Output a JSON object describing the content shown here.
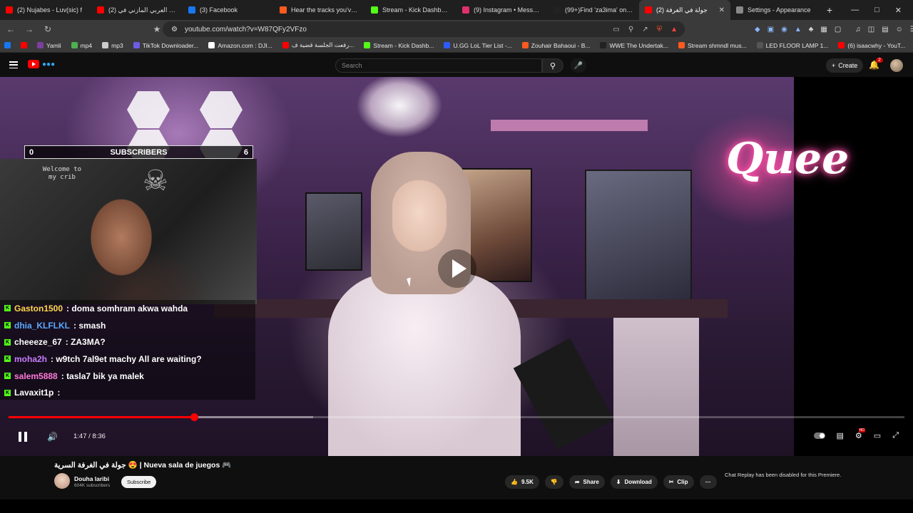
{
  "browser": {
    "tabs": [
      {
        "title": "(2) Nujabes - Luv(sic) f",
        "color": "#ff0000",
        "active": false
      },
      {
        "title": "محمد العربي المازني في (2)",
        "color": "#ff0000",
        "active": false
      },
      {
        "title": "(3) Facebook",
        "color": "#1877f2",
        "active": false
      },
      {
        "title": "Hear the tracks you've lik",
        "color": "#ff5a1f",
        "active": false
      },
      {
        "title": "Stream - Kick Dashboard",
        "color": "#53fc18",
        "active": false
      },
      {
        "title": "(9) Instagram • Messages",
        "color": "#e1306c",
        "active": false
      },
      {
        "title": "(99+)Find 'za3ima' on TikT",
        "color": "#222222",
        "active": false
      },
      {
        "title": "جولة في الغرفة (2)",
        "color": "#ff0000",
        "active": true
      },
      {
        "title": "Settings - Appearance",
        "color": "#888888",
        "active": false
      }
    ],
    "url": "youtube.com/watch?v=W87QFy2VFzo",
    "bookmarks": [
      {
        "label": "",
        "color": "#1877f2"
      },
      {
        "label": "",
        "color": "#ff0000"
      },
      {
        "label": "Yamli",
        "color": "#7b3fa0"
      },
      {
        "label": "mp4",
        "color": "#4caf50"
      },
      {
        "label": "mp3",
        "color": "#cccccc"
      },
      {
        "label": "TikTok Downloader...",
        "color": "#6c5ce7"
      },
      {
        "label": "Amazon.com : DJI...",
        "color": "#ffffff"
      },
      {
        "label": "رفعت الجلسة قضية ف...",
        "color": "#ff0000"
      },
      {
        "label": "Stream - Kick Dashb...",
        "color": "#53fc18"
      },
      {
        "label": "U.GG LoL Tier List -...",
        "color": "#2e5bff"
      },
      {
        "label": "Zouhair Bahaoui - B...",
        "color": "#ff5a1f"
      },
      {
        "label": "WWE The Undertak...",
        "color": "#222222"
      },
      {
        "label": "Stream shmndl mus...",
        "color": "#ff5a1f"
      },
      {
        "label": "LED FLOOR LAMP 1...",
        "color": "#555555"
      },
      {
        "label": "(6) isaacwhy - YouT...",
        "color": "#ff0000"
      },
      {
        "label": "st",
        "color": "#ff0000"
      }
    ]
  },
  "youtube": {
    "search_placeholder": "Search",
    "create_label": "Create",
    "notification_count": "2"
  },
  "overlay": {
    "subscribers_label": "SUBSCRIBERS",
    "subscribers_left": "0",
    "subscribers_right": "6",
    "webcam_text": "Welcome to my crib",
    "chat": [
      {
        "user": "Gaston1500",
        "message": ": doma somhram akwa wahda",
        "user_color": "#ffd84a"
      },
      {
        "user": "dhia_KLFLKL",
        "message": ": smash",
        "user_color": "#5aa9ff"
      },
      {
        "user": "cheeeze_67",
        "message": ": ZA3MA?",
        "user_color": "#ffffff"
      },
      {
        "user": "moha2h",
        "message": ": w9tch 7al9et machy All are waiting?",
        "user_color": "#c77dff"
      },
      {
        "user": "salem5888",
        "message": ": tasla7 bik ya malek",
        "user_color": "#ff7ad9"
      },
      {
        "user": "Lavaxit1p",
        "message": ":",
        "user_color": "#ffffff"
      }
    ],
    "neon_text": "Quee"
  },
  "player": {
    "current_time": "1:47",
    "duration": "8:36",
    "time_display": "1:47 / 8:36",
    "progress_fraction": 0.207,
    "loaded_fraction": 0.34,
    "hd_badge": "HD"
  },
  "video_info": {
    "title": "جولة في الغرفة السرية 😍 | Nueva sala de juegos 🎮",
    "channel_name": "Douha laribi",
    "subscribers": "604K subscribers",
    "subscribe_label": "Subscribe",
    "likes": "9.5K",
    "share_label": "Share",
    "download_label": "Download",
    "clip_label": "Clip",
    "chat_replay_note": "Chat Replay has been disabled for this Premiere."
  }
}
